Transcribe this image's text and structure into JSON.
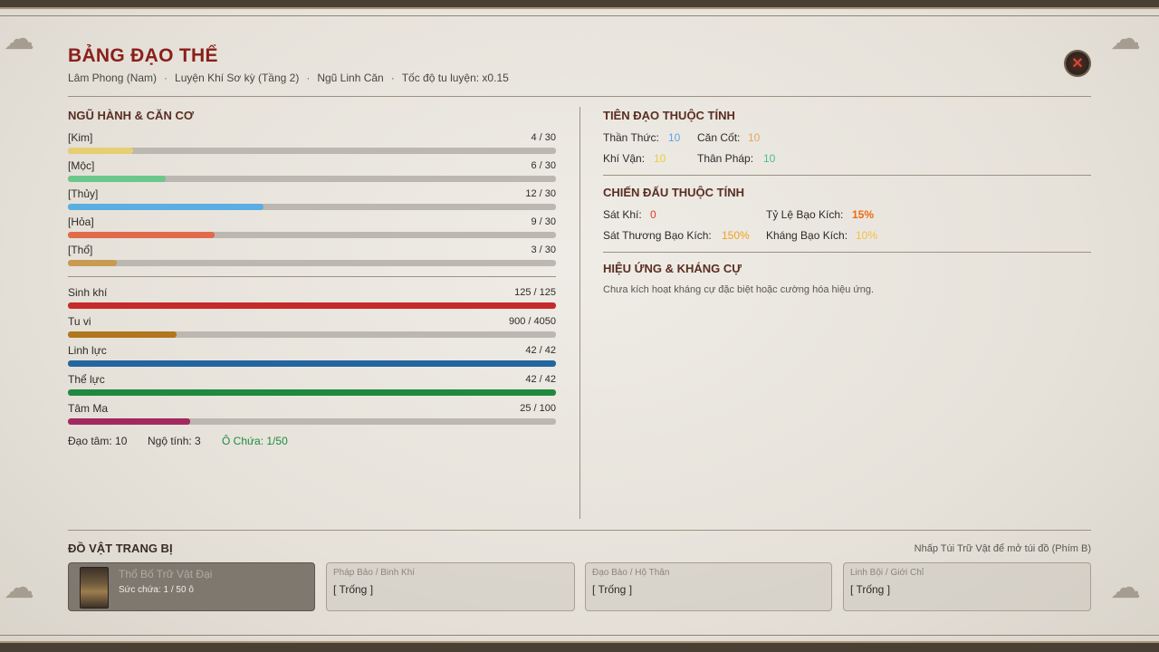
{
  "header": {
    "title": "BẢNG ĐẠO THỂ",
    "subtitle": [
      "Lâm Phong (Nam)",
      "Luyện Khí Sơ kỳ (Tầng 2)",
      "Ngũ Linh Căn",
      "Tốc độ tu luyện: x0.15"
    ]
  },
  "close_icon": "close-icon",
  "left": {
    "elements_title": "NGŨ HÀNH & CĂN CƠ",
    "elements": [
      {
        "label": "[Kim]",
        "value": "4 / 30",
        "ratio": 0.1333,
        "color": "#e6cf72"
      },
      {
        "label": "[Mộc]",
        "value": "6 / 30",
        "ratio": 0.2,
        "color": "#6cc78a"
      },
      {
        "label": "[Thủy]",
        "value": "12 / 30",
        "ratio": 0.4,
        "color": "#5aaee2"
      },
      {
        "label": "[Hỏa]",
        "value": "9 / 30",
        "ratio": 0.3,
        "color": "#e06a4a"
      },
      {
        "label": "[Thổ]",
        "value": "3 / 30",
        "ratio": 0.1,
        "color": "#c89a52"
      }
    ],
    "vitals": [
      {
        "label": "Sinh khí",
        "value": "125 / 125",
        "ratio": 1.0,
        "color": "#c62a2a"
      },
      {
        "label": "Tu vi",
        "value": "900 / 4050",
        "ratio": 0.2222,
        "color": "#b0771e"
      },
      {
        "label": "Linh lực",
        "value": "42 / 42",
        "ratio": 1.0,
        "color": "#2365a0"
      },
      {
        "label": "Thể lực",
        "value": "42 / 42",
        "ratio": 1.0,
        "color": "#1f8a3f"
      },
      {
        "label": "Tâm Ma",
        "value": "25 / 100",
        "ratio": 0.25,
        "color": "#a2295f"
      }
    ],
    "footer": {
      "dao_tam": "Đạo tâm: 10",
      "ngo_tinh": "Ngộ tính: 3",
      "o_chua": "Ô Chứa: 1/50"
    }
  },
  "right": {
    "tien_dao_title": "TIÊN ĐẠO THUỘC TÍNH",
    "tien_dao": [
      {
        "label": "Thần Thức:",
        "value": "10",
        "color": "#5aa6e6"
      },
      {
        "label": "Căn Cốt:",
        "value": "10",
        "color": "#e0a860"
      },
      {
        "label": "Khí Vận:",
        "value": "10",
        "color": "#e6cf40"
      },
      {
        "label": "Thân Pháp:",
        "value": "10",
        "color": "#48c08a"
      }
    ],
    "chien_dau_title": "CHIẾN ĐẤU THUỘC TÍNH",
    "chien_dau": [
      {
        "label": "Sát Khí:",
        "value": "0",
        "color": "#e23a2a"
      },
      {
        "label": "Tỷ Lệ Bạo Kích:",
        "value": "15%",
        "color": "#ee6a10"
      },
      {
        "label": "Sát Thương Bạo Kích:",
        "value": "150%",
        "color": "#f0a020"
      },
      {
        "label": "Kháng Bạo Kích:",
        "value": "10%",
        "color": "#f0c040"
      }
    ],
    "effects_title": "HIỆU ỨNG & KHÁNG CỰ",
    "effects_note": "Chưa kích hoạt kháng cự đặc biệt hoặc cường hóa hiệu ứng."
  },
  "equipment": {
    "title": "ĐỒ VẬT TRANG BỊ",
    "hint": "Nhấp Túi Trữ Vật để mở túi đồ (Phím B)",
    "bag": {
      "name": "Thổ Bố Trữ Vật Đại",
      "capacity": "Sức chứa: 1 / 50 ô"
    },
    "slots": [
      {
        "type": "Pháp Bảo / Binh Khí",
        "value": "[ Trống ]"
      },
      {
        "type": "Đạo Bào / Hộ Thân",
        "value": "[ Trống ]"
      },
      {
        "type": "Linh Bội / Giới Chỉ",
        "value": "[ Trống ]"
      }
    ]
  }
}
